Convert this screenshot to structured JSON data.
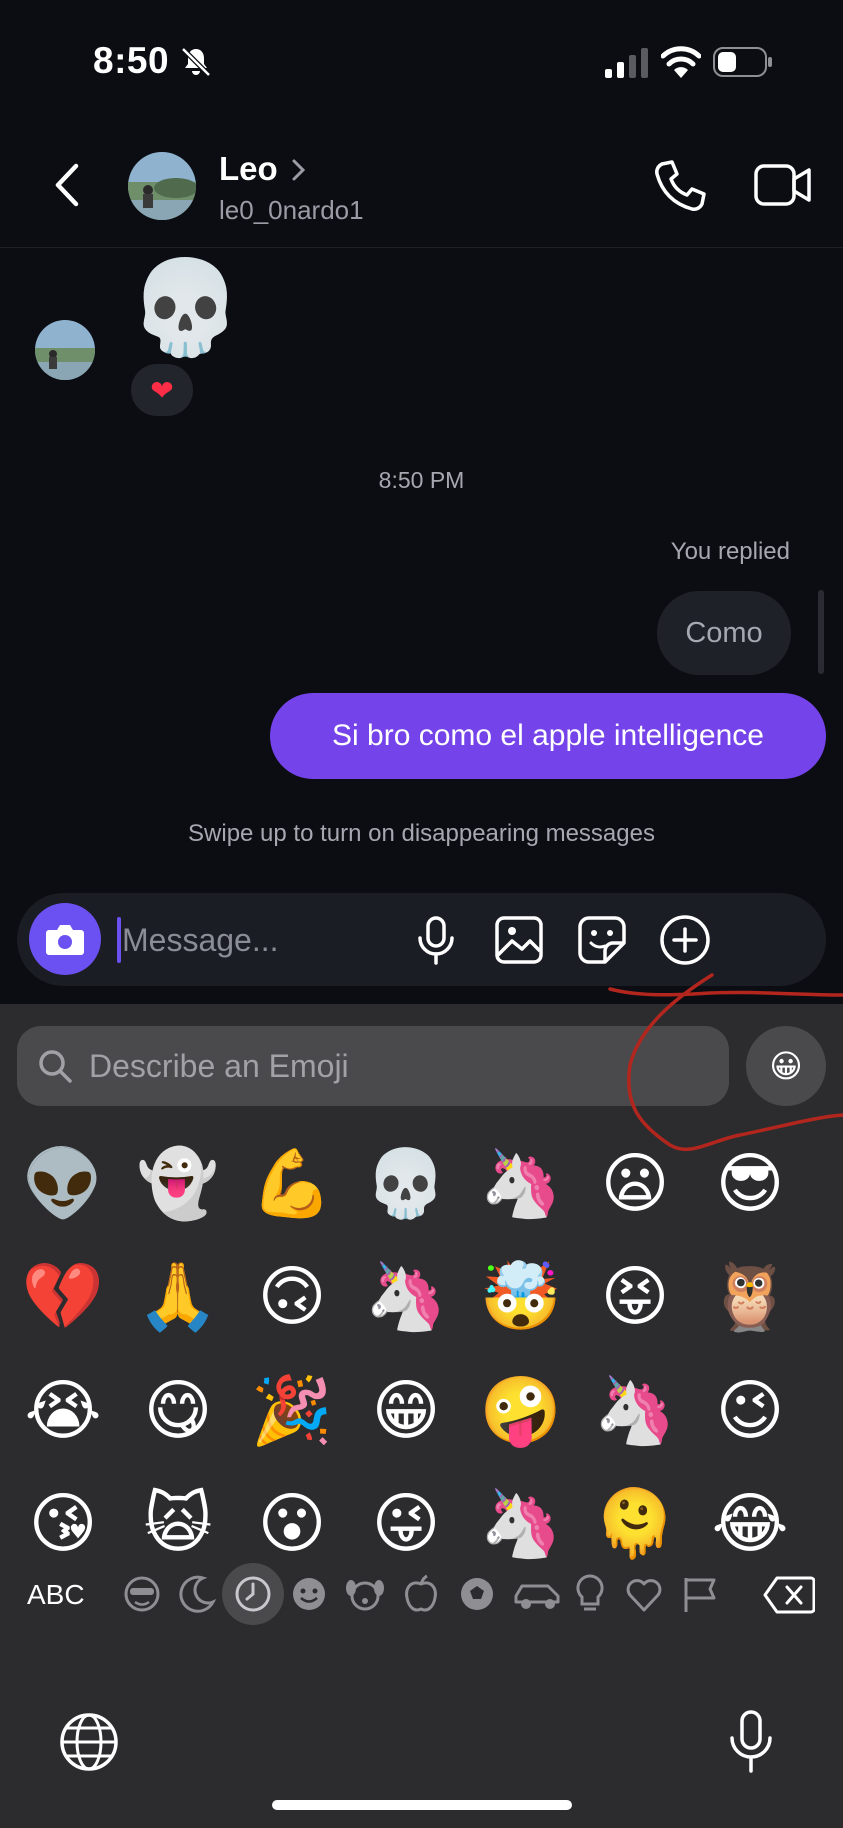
{
  "status_bar": {
    "time": "8:50",
    "icons": [
      "bell-slash-icon",
      "signal-icon",
      "wifi-icon",
      "battery-icon"
    ]
  },
  "header": {
    "name": "Leo",
    "username": "le0_0nardo1",
    "icons": [
      "back-icon",
      "chevron-right-icon",
      "phone-icon",
      "video-icon"
    ]
  },
  "conversation": {
    "received_emoji": "💀",
    "reaction": "❤",
    "timestamp": "8:50 PM",
    "you_replied_label": "You replied",
    "replied_to_text": "Como",
    "sent_message": "Si bro como el apple intelligence",
    "disappearing_hint": "Swipe up to turn on disappearing messages"
  },
  "composer": {
    "placeholder": "Message...",
    "icons": [
      "camera-icon",
      "microphone-icon",
      "gallery-icon",
      "sticker-icon",
      "plus-icon"
    ]
  },
  "keyboard": {
    "search_placeholder": "Describe an Emoji",
    "genmoji_icon": "genmoji-icon",
    "emojis": [
      [
        "👽",
        "👻",
        "💪",
        "💀",
        "🦄",
        "😦",
        "😎"
      ],
      [
        "💔",
        "🙏",
        "🙃",
        "🦄",
        "🤯",
        "😝",
        "🦉"
      ],
      [
        "😭",
        "😋",
        "🎉",
        "😁",
        "🤪",
        "🦄",
        "😉"
      ],
      [
        "😘",
        "🙀",
        "😮",
        "😜",
        "🦄",
        "🫠",
        "😂"
      ]
    ],
    "abc_label": "ABC",
    "categories": [
      "memoji-icon",
      "moon-icon",
      "clock-icon",
      "smiley-icon",
      "animal-icon",
      "food-icon",
      "ball-icon",
      "car-icon",
      "bulb-icon",
      "heart-icon",
      "flag-icon"
    ],
    "selected_category": "clock-icon",
    "colors": {
      "accent": "#7543ea",
      "camera": "#6b51f2",
      "keyboard_bg": "#2c2c2e",
      "annotation": "#b3261e"
    }
  }
}
